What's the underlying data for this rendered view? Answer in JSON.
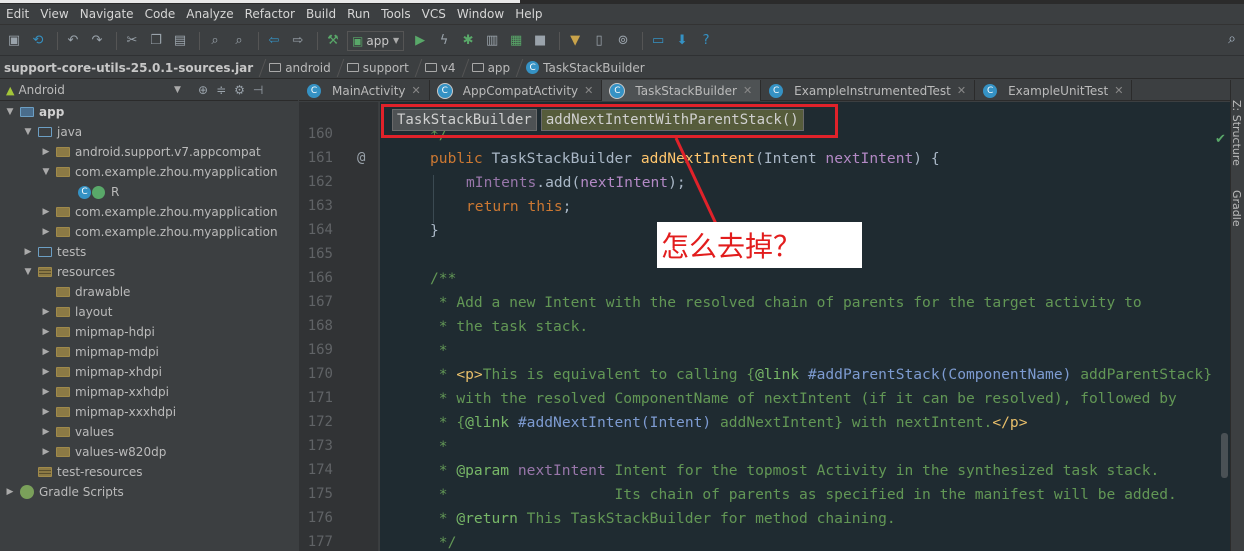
{
  "menu": [
    "Edit",
    "View",
    "Navigate",
    "Code",
    "Analyze",
    "Refactor",
    "Build",
    "Run",
    "Tools",
    "VCS",
    "Window",
    "Help"
  ],
  "toolbar": {
    "run_config": "app",
    "icons": [
      "save-icon",
      "sync-icon",
      "undo-icon",
      "redo-icon",
      "cut-icon",
      "copy-icon",
      "paste-icon",
      "find-icon",
      "replace-icon",
      "back-icon",
      "forward-icon",
      "make-icon",
      "run-icon",
      "apply-changes-icon",
      "debug-icon",
      "coverage-icon",
      "profile-icon",
      "stop-icon",
      "sdk-manager-icon",
      "avd-manager-icon",
      "project-structure-icon",
      "android-monitor-icon",
      "help-icon",
      "search-everywhere-icon"
    ]
  },
  "breadcrumbs": [
    "support-core-utils-25.0.1-sources.jar",
    "android",
    "support",
    "v4",
    "app",
    "TaskStackBuilder"
  ],
  "project_panel": {
    "view_mode": "Android",
    "tree": [
      {
        "label": "app",
        "level": 0,
        "expanded": true,
        "kind": "module"
      },
      {
        "label": "java",
        "level": 1,
        "expanded": true,
        "kind": "src"
      },
      {
        "label": "android.support.v7.appcompat",
        "level": 2,
        "expanded": false,
        "kind": "package"
      },
      {
        "label": "com.example.zhou.myapplication",
        "level": 2,
        "expanded": true,
        "kind": "package"
      },
      {
        "label": "R",
        "level": 3,
        "expanded": null,
        "kind": "class"
      },
      {
        "label": "com.example.zhou.myapplication",
        "level": 2,
        "expanded": false,
        "kind": "package"
      },
      {
        "label": "com.example.zhou.myapplication",
        "level": 2,
        "expanded": false,
        "kind": "package"
      },
      {
        "label": "tests",
        "level": 1,
        "expanded": false,
        "kind": "src"
      },
      {
        "label": "resources",
        "level": 1,
        "expanded": true,
        "kind": "res"
      },
      {
        "label": "drawable",
        "level": 2,
        "expanded": null,
        "kind": "package"
      },
      {
        "label": "layout",
        "level": 2,
        "expanded": false,
        "kind": "package"
      },
      {
        "label": "mipmap-hdpi",
        "level": 2,
        "expanded": false,
        "kind": "package"
      },
      {
        "label": "mipmap-mdpi",
        "level": 2,
        "expanded": false,
        "kind": "package"
      },
      {
        "label": "mipmap-xhdpi",
        "level": 2,
        "expanded": false,
        "kind": "package"
      },
      {
        "label": "mipmap-xxhdpi",
        "level": 2,
        "expanded": false,
        "kind": "package"
      },
      {
        "label": "mipmap-xxxhdpi",
        "level": 2,
        "expanded": false,
        "kind": "package"
      },
      {
        "label": "values",
        "level": 2,
        "expanded": false,
        "kind": "package"
      },
      {
        "label": "values-w820dp",
        "level": 2,
        "expanded": false,
        "kind": "package"
      },
      {
        "label": "test-resources",
        "level": 1,
        "expanded": null,
        "kind": "res"
      },
      {
        "label": "Gradle Scripts",
        "level": 0,
        "expanded": false,
        "kind": "gradle"
      }
    ]
  },
  "tabs": [
    {
      "label": "MainActivity",
      "active": false
    },
    {
      "label": "AppCompatActivity",
      "active": false
    },
    {
      "label": "TaskStackBuilder",
      "active": true
    },
    {
      "label": "ExampleInstrumentedTest",
      "active": false
    },
    {
      "label": "ExampleUnitTest",
      "active": false
    }
  ],
  "editor_nav": {
    "class": "TaskStackBuilder",
    "method": "addNextIntentWithParentStack()"
  },
  "annotation": "怎么去掉？",
  "code_lines": [
    {
      "n": "160",
      "text": "     */"
    },
    {
      "n": "161",
      "text": "public TaskStackBuilder addNextIntent(Intent nextIntent) {"
    },
    {
      "n": "162",
      "text": "    mIntents.add(nextIntent);"
    },
    {
      "n": "163",
      "text": "    return this;"
    },
    {
      "n": "164",
      "text": "}"
    },
    {
      "n": "165",
      "text": ""
    },
    {
      "n": "166",
      "text": "/**"
    },
    {
      "n": "167",
      "text": " * Add a new Intent with the resolved chain of parents for the target activity to"
    },
    {
      "n": "168",
      "text": " * the task stack."
    },
    {
      "n": "169",
      "text": " *"
    },
    {
      "n": "170",
      "text": " * <p>This is equivalent to calling {@link #addParentStack(ComponentName) addParentStack}"
    },
    {
      "n": "171",
      "text": " * with the resolved ComponentName of nextIntent (if it can be resolved), followed by"
    },
    {
      "n": "172",
      "text": " * {@link #addNextIntent(Intent) addNextIntent} with nextIntent.</p>"
    },
    {
      "n": "173",
      "text": " *"
    },
    {
      "n": "174",
      "text": " * @param nextIntent Intent for the topmost Activity in the synthesized task stack."
    },
    {
      "n": "175",
      "text": " *                   Its chain of parents as specified in the manifest will be added."
    },
    {
      "n": "176",
      "text": " * @return This TaskStackBuilder for method chaining."
    },
    {
      "n": "177",
      "text": " */"
    }
  ],
  "right_tools": [
    "Z: Structure",
    "Gradle"
  ],
  "colors": {
    "annotation_red": "#e0222a",
    "keyword": "#cc7832",
    "doc_comment": "#629755"
  }
}
